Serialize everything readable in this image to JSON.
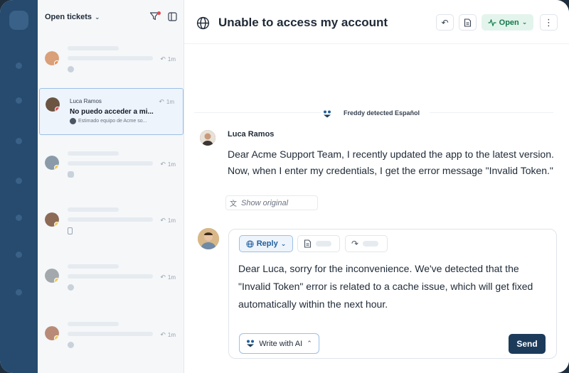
{
  "sidebar": {
    "list_title": "Open tickets"
  },
  "tickets": [
    {
      "time": "1m",
      "channel": "facebook"
    },
    {
      "name": "Luca Ramos",
      "subject": "No puedo acceder a mi...",
      "preview": "Estimado equipo de Acme so...",
      "time": "1m",
      "channel": "facebook",
      "active": true
    },
    {
      "time": "1m",
      "channel": "chat"
    },
    {
      "time": "1m",
      "channel": "mobile"
    },
    {
      "time": "1m",
      "channel": "web"
    },
    {
      "time": "1m",
      "channel": "facebook"
    }
  ],
  "conversation": {
    "title": "Unable to access my account",
    "status": "Open",
    "detected_language_note": "Freddy detected Español",
    "customer": {
      "name": "Luca Ramos",
      "message": "Dear Acme Support Team, I recently updated the app to the latest version. Now, when I enter my credentials, I get the error message \"Invalid Token.\"",
      "show_original_label": "Show original"
    },
    "composer": {
      "reply_label": "Reply",
      "reply_text": "Dear Luca, sorry for the inconvenience. We've detected that the \"Invalid Token\" error is related to a cache issue, which will get fixed automatically within the next hour.",
      "ai_label": "Write with AI",
      "send_label": "Send"
    }
  },
  "colors": {
    "rail": "#264b6e",
    "accent": "#1c3b5a",
    "status_open": "#137a4c"
  }
}
